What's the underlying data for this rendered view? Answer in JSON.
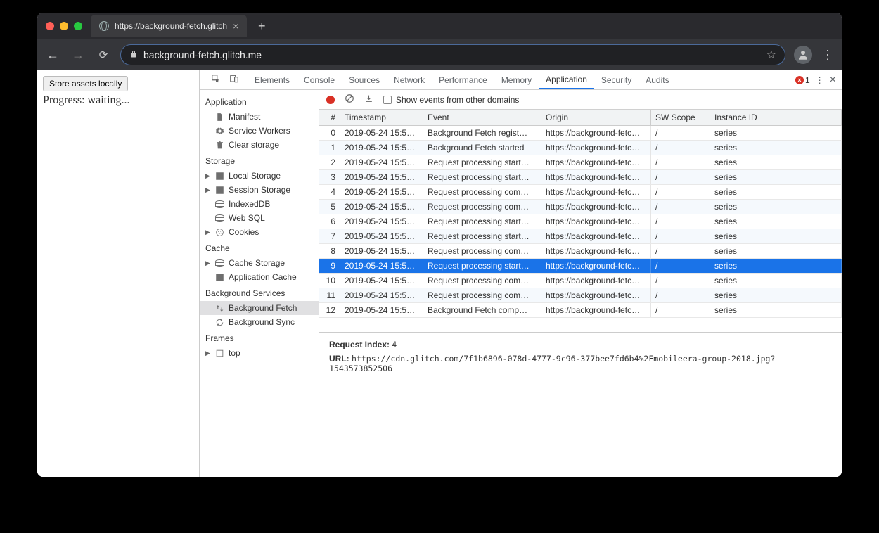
{
  "browser": {
    "tab_title": "https://background-fetch.glitch",
    "url_display": "background-fetch.glitch.me",
    "page_button": "Store assets locally",
    "progress_text": "Progress: waiting..."
  },
  "devtools": {
    "panels": [
      "Elements",
      "Console",
      "Sources",
      "Network",
      "Performance",
      "Memory",
      "Application",
      "Security",
      "Audits"
    ],
    "active_panel": "Application",
    "error_count": "1",
    "sidebar": {
      "application": {
        "title": "Application",
        "items": [
          "Manifest",
          "Service Workers",
          "Clear storage"
        ]
      },
      "storage": {
        "title": "Storage",
        "items": [
          "Local Storage",
          "Session Storage",
          "IndexedDB",
          "Web SQL",
          "Cookies"
        ]
      },
      "cache": {
        "title": "Cache",
        "items": [
          "Cache Storage",
          "Application Cache"
        ]
      },
      "background": {
        "title": "Background Services",
        "items": [
          "Background Fetch",
          "Background Sync"
        ],
        "selected": "Background Fetch"
      },
      "frames": {
        "title": "Frames",
        "items": [
          "top"
        ]
      }
    },
    "toolbar": {
      "show_events_label": "Show events from other domains"
    },
    "table": {
      "headers": [
        "#",
        "Timestamp",
        "Event",
        "Origin",
        "SW Scope",
        "Instance ID"
      ],
      "selected_index": 9,
      "rows": [
        {
          "n": "0",
          "ts": "2019-05-24 15:5…",
          "ev": "Background Fetch regist…",
          "or": "https://background-fetc…",
          "sw": "/",
          "id": "series"
        },
        {
          "n": "1",
          "ts": "2019-05-24 15:5…",
          "ev": "Background Fetch started",
          "or": "https://background-fetc…",
          "sw": "/",
          "id": "series"
        },
        {
          "n": "2",
          "ts": "2019-05-24 15:5…",
          "ev": "Request processing start…",
          "or": "https://background-fetc…",
          "sw": "/",
          "id": "series"
        },
        {
          "n": "3",
          "ts": "2019-05-24 15:5…",
          "ev": "Request processing start…",
          "or": "https://background-fetc…",
          "sw": "/",
          "id": "series"
        },
        {
          "n": "4",
          "ts": "2019-05-24 15:5…",
          "ev": "Request processing com…",
          "or": "https://background-fetc…",
          "sw": "/",
          "id": "series"
        },
        {
          "n": "5",
          "ts": "2019-05-24 15:5…",
          "ev": "Request processing com…",
          "or": "https://background-fetc…",
          "sw": "/",
          "id": "series"
        },
        {
          "n": "6",
          "ts": "2019-05-24 15:5…",
          "ev": "Request processing start…",
          "or": "https://background-fetc…",
          "sw": "/",
          "id": "series"
        },
        {
          "n": "7",
          "ts": "2019-05-24 15:5…",
          "ev": "Request processing start…",
          "or": "https://background-fetc…",
          "sw": "/",
          "id": "series"
        },
        {
          "n": "8",
          "ts": "2019-05-24 15:5…",
          "ev": "Request processing com…",
          "or": "https://background-fetc…",
          "sw": "/",
          "id": "series"
        },
        {
          "n": "9",
          "ts": "2019-05-24 15:5…",
          "ev": "Request processing start…",
          "or": "https://background-fetc…",
          "sw": "/",
          "id": "series"
        },
        {
          "n": "10",
          "ts": "2019-05-24 15:5…",
          "ev": "Request processing com…",
          "or": "https://background-fetc…",
          "sw": "/",
          "id": "series"
        },
        {
          "n": "11",
          "ts": "2019-05-24 15:5…",
          "ev": "Request processing com…",
          "or": "https://background-fetc…",
          "sw": "/",
          "id": "series"
        },
        {
          "n": "12",
          "ts": "2019-05-24 15:5…",
          "ev": "Background Fetch comp…",
          "or": "https://background-fetc…",
          "sw": "/",
          "id": "series"
        }
      ]
    },
    "details": {
      "request_index_label": "Request Index:",
      "request_index_value": "4",
      "url_label": "URL:",
      "url_value": "https://cdn.glitch.com/7f1b6896-078d-4777-9c96-377bee7fd6b4%2Fmobileera-group-2018.jpg?1543573852506"
    }
  }
}
